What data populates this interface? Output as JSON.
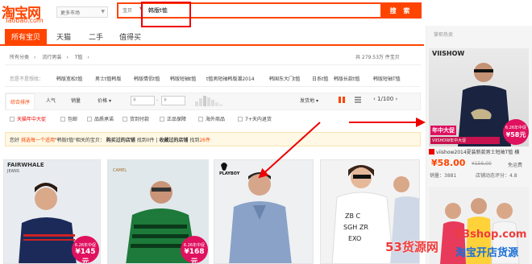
{
  "header": {
    "logo_cn": "淘宝网",
    "logo_en": "Taobao.com",
    "market_select": "更多市场",
    "search_type": "宝贝",
    "search_query": "韩版t恤",
    "search_button": "搜 索"
  },
  "tabs": [
    {
      "label": "所有宝贝",
      "active": true
    },
    {
      "label": "天猫",
      "active": false
    },
    {
      "label": "二手",
      "active": false
    },
    {
      "label": "值得买",
      "active": false
    }
  ],
  "breadcrumb": [
    "所有分类",
    "流行男装",
    "T恤"
  ],
  "result_count": "共 279.53万 件宝贝",
  "related": {
    "label": "您是不是想找：",
    "items": [
      "韩版宽松t恤",
      "男士t恤韩版",
      "韩版情侣t恤",
      "韩版短袖t恤",
      "t恤男短袖韩版潮2014",
      "韩国东大门t恤",
      "日系t恤",
      "韩版长款t恤",
      "韩版短袖T恤"
    ]
  },
  "sort": {
    "items": [
      "综合排序",
      "人气",
      "销量",
      "价格"
    ],
    "price_from": "¥",
    "price_to": "¥",
    "ship_from": "发货地",
    "pager": "1/100"
  },
  "filters": [
    {
      "label": "天猫年中大促",
      "red": true
    },
    {
      "label": "包邮",
      "red": false
    },
    {
      "label": "品质承诺",
      "red": false
    },
    {
      "label": "货到付款",
      "red": false
    },
    {
      "label": "正品保障",
      "red": false
    },
    {
      "label": "海外商品",
      "red": false
    },
    {
      "label": "7+天内退货",
      "red": false
    }
  ],
  "notice": {
    "prefix": "您好",
    "link": "挑选每一个适用",
    "middle": "\"韩版t恤\"相关的宝贝：",
    "b1": "购买过的店铺",
    "c1": "找到0件",
    "sep": "|",
    "b2": "收藏过的店铺",
    "c2_pre": "找到",
    "c2_num": "26件"
  },
  "products": [
    {
      "brand": "FAIRWHALE",
      "brand_sub": "JEANS",
      "promo": "6.26年中促",
      "price": "¥145元",
      "shirt": "#1c2a5a",
      "stripe": "#c22"
    },
    {
      "brand": "",
      "brand_sub": "CAMEL",
      "promo": "6.26年中促",
      "price": "¥168元",
      "shirt": "#1d7a3a",
      "stripe": "#0a3a1a"
    },
    {
      "brand": "",
      "brand_sub": "PLAYBOY",
      "promo": "",
      "price": "",
      "shirt": "#8aa2c8",
      "stripe": "#6a84ad"
    },
    {
      "brand": "",
      "brand_sub": "",
      "promo": "",
      "price": "",
      "shirt": "#ffffff",
      "stripe": "#222"
    }
  ],
  "right_panel": {
    "title": "掌柜热卖",
    "brand": "VIISHOW",
    "promo1": "年中大促",
    "promo2": "VIISHOW年中大促",
    "badge_date": "6.26年中促",
    "badge_price": "¥58元",
    "item_title": "viishow2014夏装新款男士短袖T恤 横",
    "price": "¥58.00",
    "old_price": "¥156.00",
    "shipping": "免运费",
    "sales": "销量：3881",
    "rating": "店铺动态评分：4.8"
  },
  "watermark": {
    "cn": "53货源网",
    "url": "53shop.com",
    "tagline": "淘宝开店货源"
  },
  "colors": {
    "accent": "#ff4400",
    "red_box": "#e00000",
    "arrow": "#e00000"
  }
}
